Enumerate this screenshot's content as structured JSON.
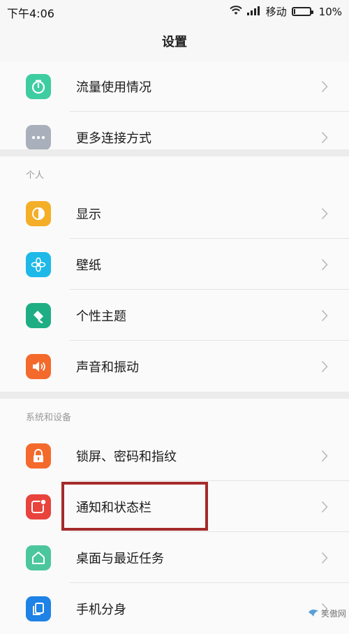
{
  "status_bar": {
    "time": "下午4:06",
    "carrier": "移动",
    "battery": "10%",
    "battery_level": 0.1
  },
  "header": {
    "title": "设置"
  },
  "top_items": [
    {
      "label": "流量使用情况",
      "icon": "data-usage-icon",
      "color": "#3ecda0"
    },
    {
      "label": "更多连接方式",
      "icon": "more-connection-icon",
      "color": "#a9b0bb"
    }
  ],
  "personal": {
    "header": "个人",
    "items": [
      {
        "label": "显示",
        "icon": "display-icon",
        "color": "#f4ae27"
      },
      {
        "label": "壁纸",
        "icon": "wallpaper-icon",
        "color": "#1eb9e8"
      },
      {
        "label": "个性主题",
        "icon": "theme-icon",
        "color": "#1fae84"
      },
      {
        "label": "声音和振动",
        "icon": "sound-icon",
        "color": "#f46a2c"
      }
    ]
  },
  "system": {
    "header": "系统和设备",
    "items": [
      {
        "label": "锁屏、密码和指纹",
        "icon": "lock-icon",
        "color": "#f46a2c"
      },
      {
        "label": "通知和状态栏",
        "icon": "notification-icon",
        "color": "#e8433c"
      },
      {
        "label": "桌面与最近任务",
        "icon": "home-icon",
        "color": "#4cc79d"
      },
      {
        "label": "手机分身",
        "icon": "clone-icon",
        "color": "#1e82e6"
      }
    ]
  },
  "watermark": "笑傲网"
}
